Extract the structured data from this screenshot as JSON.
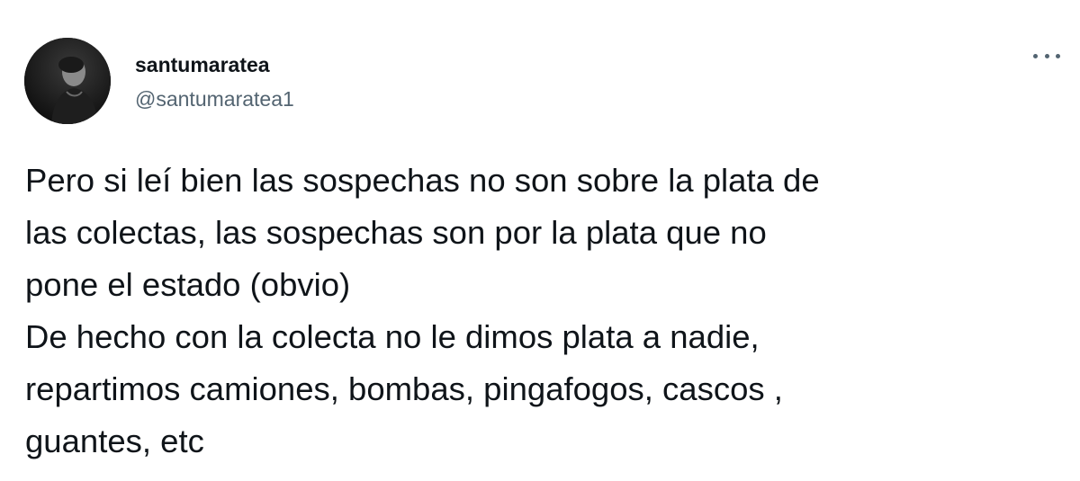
{
  "user": {
    "display_name": "santumaratea",
    "handle": "@santumaratea1"
  },
  "icons": {
    "avatar": "profile-photo",
    "more": "more-options-icon"
  },
  "tweet": {
    "lines": [
      "Pero si leí bien las sospechas no son sobre la plata de",
      "las colectas, las sospechas son por la plata que no",
      "pone el estado (obvio)",
      "De hecho con la colecta no le dimos plata a nadie,",
      "repartimos camiones, bombas, pingafogos, cascos ,",
      "guantes, etc"
    ]
  },
  "colors": {
    "text": "#0f1419",
    "secondary": "#536471",
    "background": "#ffffff"
  }
}
